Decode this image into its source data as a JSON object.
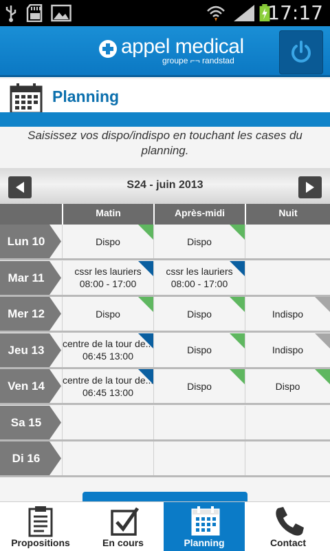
{
  "status_bar": {
    "time": "17:17",
    "icons": [
      "usb-icon",
      "sd-card-icon",
      "image-icon",
      "wifi-icon",
      "signal-icon",
      "battery-icon"
    ]
  },
  "header": {
    "brand": "appel medical",
    "brand_sub": "groupe ⌐¬ randstad",
    "power_icon": "power-icon"
  },
  "title_bar": {
    "title": "Planning",
    "icon": "calendar-icon"
  },
  "instructions": "Saisissez vos dispo/indispo en touchant les cases du planning.",
  "week_nav": {
    "label": "S24 - juin 2013",
    "prev_icon": "prev-arrow-icon",
    "next_icon": "next-arrow-icon"
  },
  "columns": [
    "Matin",
    "Après-midi",
    "Nuit"
  ],
  "colors": {
    "accent": "#0b7bc7",
    "dispo": "#5fb760",
    "mission": "#0a5fa0",
    "indispo": "#a7a7a7",
    "day_tag": "#7a7a7a"
  },
  "rows": [
    {
      "day": "Lun 10",
      "cells": [
        {
          "l1": "Dispo",
          "l2": "",
          "state": "dispo"
        },
        {
          "l1": "Dispo",
          "l2": "",
          "state": "dispo"
        },
        {
          "l1": "",
          "l2": "",
          "state": ""
        }
      ]
    },
    {
      "day": "Mar 11",
      "cells": [
        {
          "l1": "cssr les lauriers",
          "l2": "08:00 - 17:00",
          "state": "mission"
        },
        {
          "l1": "cssr les lauriers",
          "l2": "08:00 - 17:00",
          "state": "mission"
        },
        {
          "l1": "",
          "l2": "",
          "state": ""
        }
      ]
    },
    {
      "day": "Mer 12",
      "cells": [
        {
          "l1": "Dispo",
          "l2": "",
          "state": "dispo"
        },
        {
          "l1": "Dispo",
          "l2": "",
          "state": "dispo"
        },
        {
          "l1": "Indispo",
          "l2": "",
          "state": "indispo"
        }
      ]
    },
    {
      "day": "Jeu 13",
      "cells": [
        {
          "l1": "centre de la tour de...",
          "l2": "06:45 13:00",
          "state": "mission"
        },
        {
          "l1": "Dispo",
          "l2": "",
          "state": "dispo"
        },
        {
          "l1": "Indispo",
          "l2": "",
          "state": "indispo"
        }
      ]
    },
    {
      "day": "Ven 14",
      "cells": [
        {
          "l1": "centre de la tour de...",
          "l2": "06:45 13:00",
          "state": "mission"
        },
        {
          "l1": "Dispo",
          "l2": "",
          "state": "dispo"
        },
        {
          "l1": "Dispo",
          "l2": "",
          "state": "dispo"
        }
      ]
    },
    {
      "day": "Sa 15",
      "cells": [
        {
          "l1": "",
          "l2": "",
          "state": ""
        },
        {
          "l1": "",
          "l2": "",
          "state": ""
        },
        {
          "l1": "",
          "l2": "",
          "state": ""
        }
      ]
    },
    {
      "day": "Di 16",
      "cells": [
        {
          "l1": "",
          "l2": "",
          "state": ""
        },
        {
          "l1": "",
          "l2": "",
          "state": ""
        },
        {
          "l1": "",
          "l2": "",
          "state": ""
        }
      ]
    }
  ],
  "tabs": [
    {
      "label": "Propositions",
      "icon": "clipboard-list-icon",
      "active": false
    },
    {
      "label": "En cours",
      "icon": "checkbox-icon",
      "active": false
    },
    {
      "label": "Planning",
      "icon": "calendar-icon",
      "active": true
    },
    {
      "label": "Contact",
      "icon": "phone-icon",
      "active": false
    }
  ]
}
